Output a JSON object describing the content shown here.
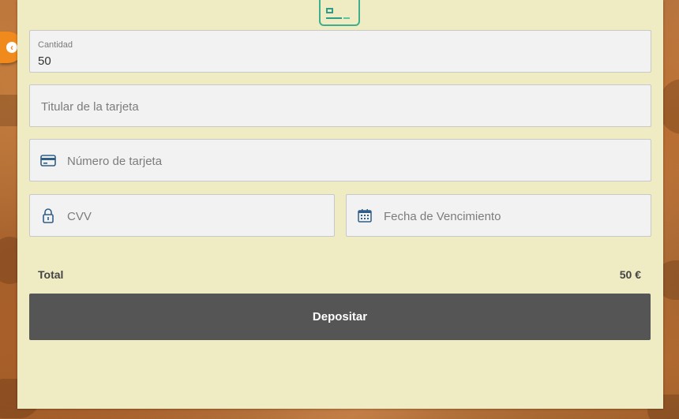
{
  "form": {
    "amount": {
      "label": "Cantidad",
      "value": "50"
    },
    "cardholder": {
      "placeholder": "Titular de la tarjeta"
    },
    "card_number": {
      "placeholder": "Número de tarjeta",
      "icon": "credit-card-icon"
    },
    "cvv": {
      "placeholder": "CVV",
      "icon": "lock-icon"
    },
    "expiry": {
      "placeholder": "Fecha de Vencimiento",
      "icon": "calendar-icon"
    }
  },
  "summary": {
    "total_label": "Total",
    "total_value": "50 €"
  },
  "actions": {
    "deposit_label": "Depositar"
  },
  "colors": {
    "panel_bg": "#efecc3",
    "button_bg": "#555555",
    "accent_orange": "#f08a1c",
    "logo_green": "#3eaf8e",
    "icon_blue": "#2f5e86"
  }
}
